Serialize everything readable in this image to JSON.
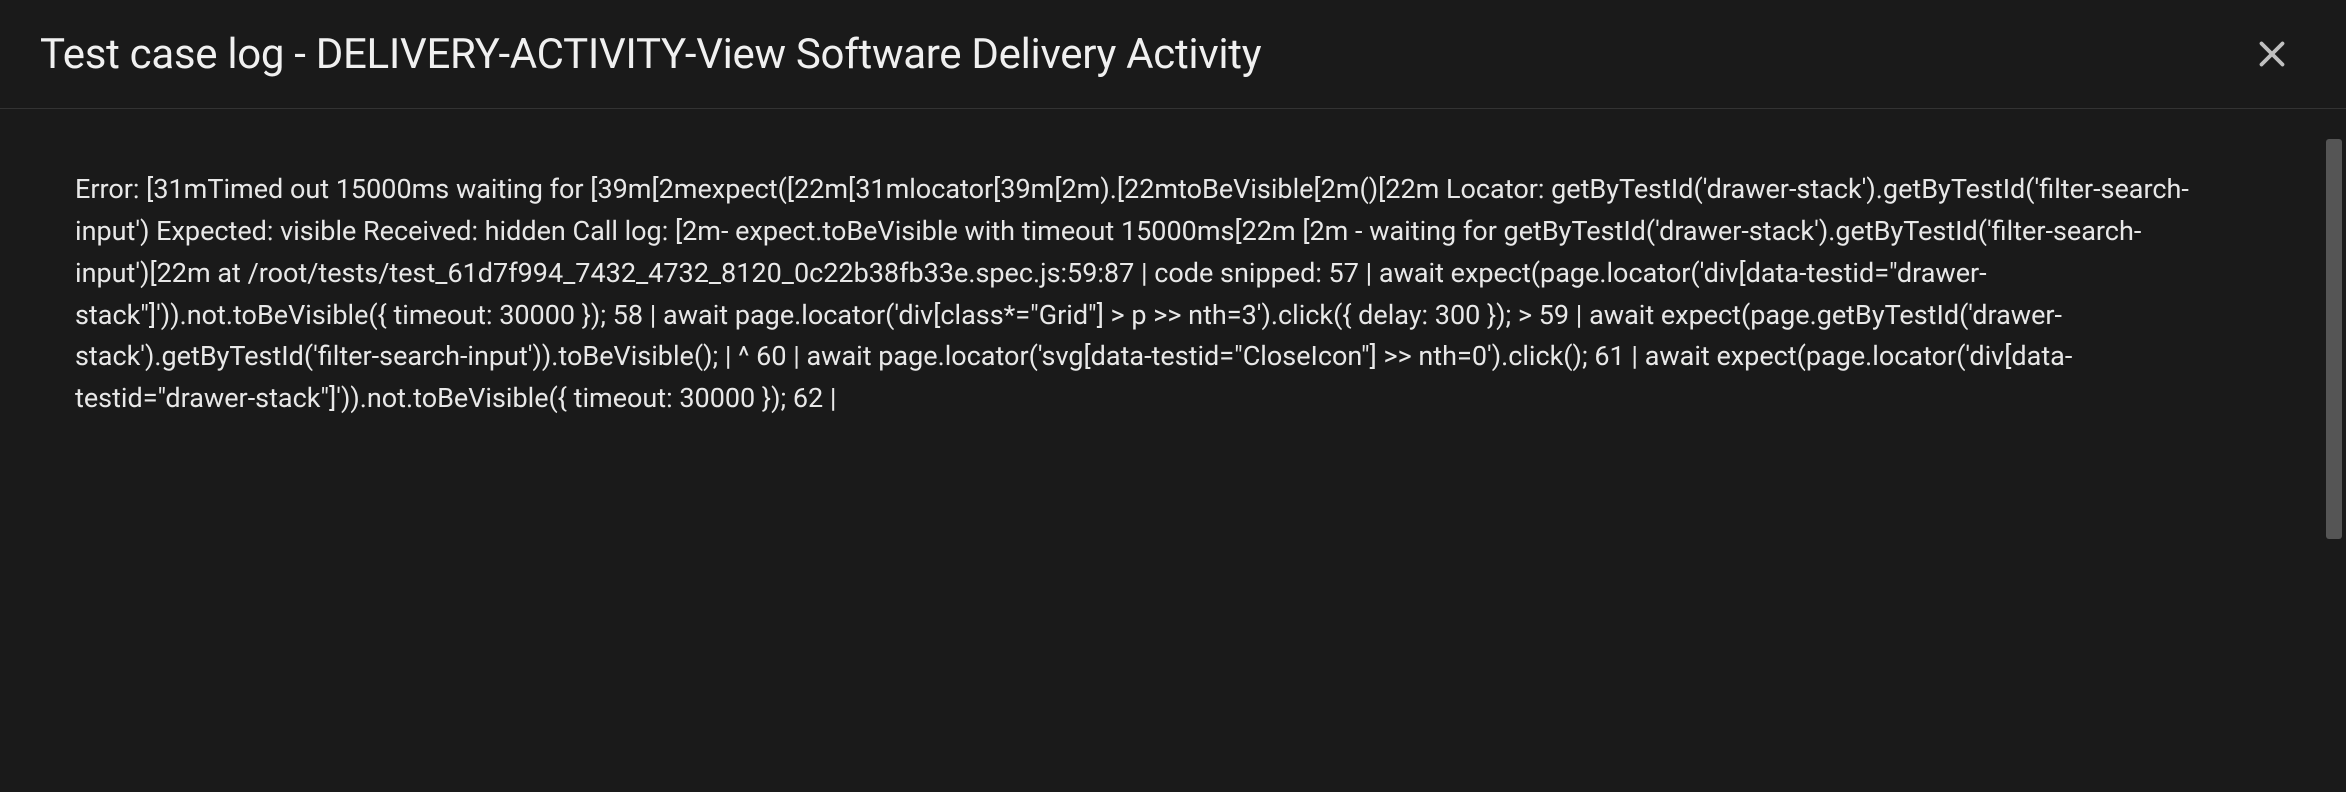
{
  "modal": {
    "title": "Test case log - DELIVERY-ACTIVITY-View Software Delivery Activity"
  },
  "log": {
    "content": "Error: \u001b[31mTimed out 15000ms waiting for \u001b[39m\u001b[2mexpect(\u001b[22m\u001b[31mlocator\u001b[39m\u001b[2m).\u001b[22mtoBeVisible\u001b[2m()\u001b[22m Locator: getByTestId('drawer-stack').getByTestId('filter-search-input') Expected: visible Received: hidden Call log: \u001b[2m- expect.toBeVisible with timeout 15000ms\u001b[22m \u001b[2m - waiting for getByTestId('drawer-stack').getByTestId('filter-search-input')\u001b[22m at /root/tests/test_61d7f994_7432_4732_8120_0c22b38fb33e.spec.js:59:87 | code snipped: 57 | await expect(page.locator('div[data-testid=\"drawer-stack\"]')).not.toBeVisible({ timeout: 30000 }); 58 | await page.locator('div[class*=\"Grid\"] > p >> nth=3').click({ delay: 300 }); > 59 | await expect(page.getByTestId('drawer-stack').getByTestId('filter-search-input')).toBeVisible(); | ^ 60 | await page.locator('svg[data-testid=\"CloseIcon\"] >> nth=0').click(); 61 | await expect(page.locator('div[data-testid=\"drawer-stack\"]')).not.toBeVisible({ timeout: 30000 }); 62 |"
  }
}
